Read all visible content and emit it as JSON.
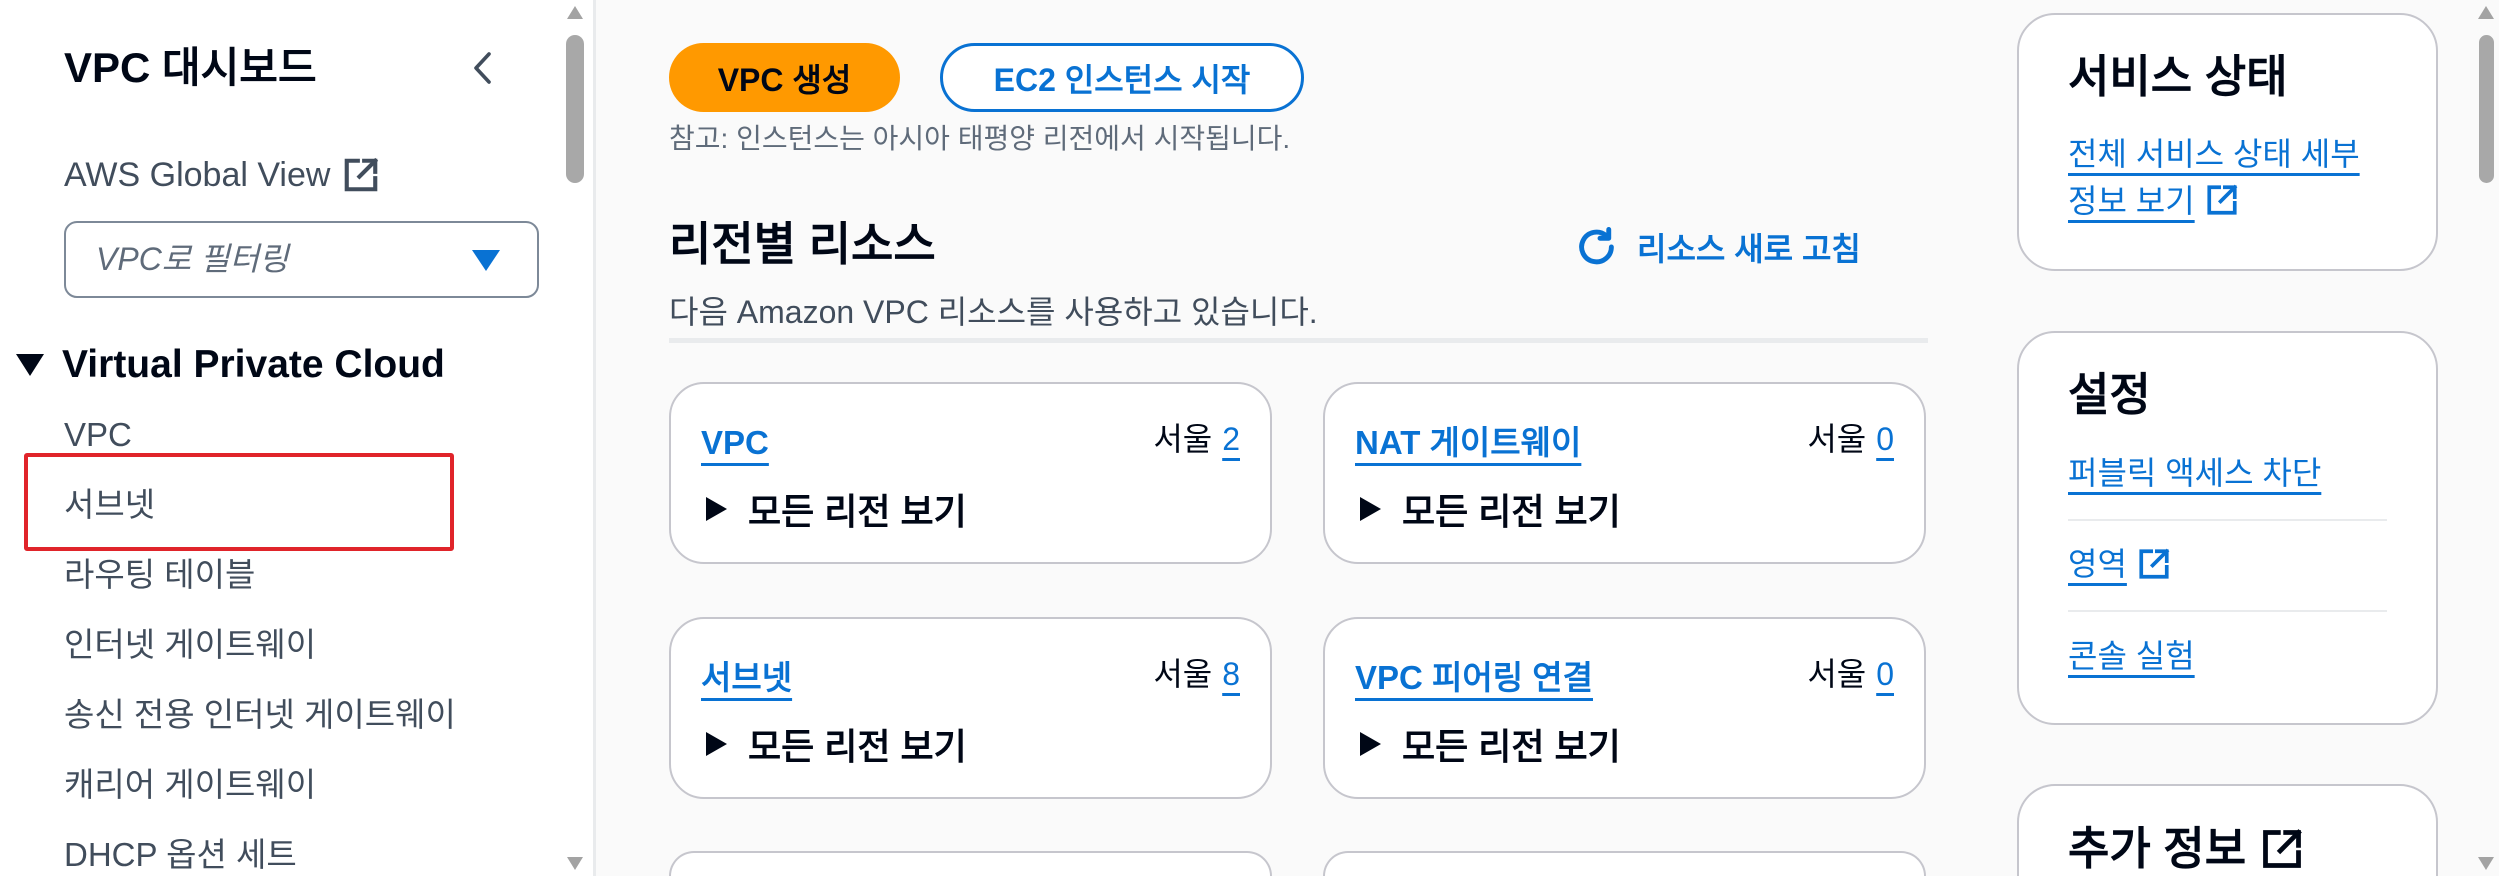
{
  "sidebar": {
    "title": "VPC 대시보드",
    "collapse_icon": "chevron-left-icon",
    "global_view": {
      "label": "AWS Global View",
      "icon": "external-link-icon"
    },
    "filter": {
      "placeholder": "VPC로 필터링",
      "icon": "caret-down-icon"
    },
    "section": {
      "title": "Virtual Private Cloud",
      "expanded": true,
      "icon": "caret-down-icon"
    },
    "items": [
      {
        "label": "VPC"
      },
      {
        "label": "서브넷",
        "highlighted": true
      },
      {
        "label": "라우팅 테이블"
      },
      {
        "label": "인터넷 게이트웨이"
      },
      {
        "label": "송신 전용 인터넷 게이트웨이"
      },
      {
        "label": "캐리어 게이트웨이"
      },
      {
        "label": "DHCP 옵션 세트"
      }
    ]
  },
  "actions": {
    "create_vpc_label": "VPC 생성",
    "launch_instance_label": "EC2 인스턴스 시작",
    "note": "참고: 인스턴스는 아시아 태평양 리전에서 시작됩니다."
  },
  "resources": {
    "title": "리전별 리소스",
    "refresh_label": "리소스 새로 고침",
    "refresh_icon": "refresh-icon",
    "description": "다음 Amazon VPC 리소스를 사용하고 있습니다.",
    "expand_icon": "caret-right-icon",
    "cards": [
      {
        "name": "VPC",
        "region": "서울",
        "count": "2",
        "expand_label": "모든 리전 보기"
      },
      {
        "name": "NAT 게이트웨이",
        "region": "서울",
        "count": "0",
        "expand_label": "모든 리전 보기"
      },
      {
        "name": "서브넷",
        "region": "서울",
        "count": "8",
        "expand_label": "모든 리전 보기"
      },
      {
        "name": "VPC 피어링 연결",
        "region": "서울",
        "count": "0",
        "expand_label": "모든 리전 보기"
      }
    ]
  },
  "service_health": {
    "title": "서비스 상태",
    "details_link": "전체 서비스 상태 세부 정보 보기",
    "details_icon": "external-link-icon"
  },
  "settings": {
    "title": "설정",
    "links": [
      {
        "label": "퍼블릭 액세스 차단",
        "external": false
      },
      {
        "label": "영역",
        "external": true
      },
      {
        "label": "콘솔 실험",
        "external": false
      }
    ]
  },
  "additional_info": {
    "title": "추가 정보",
    "icon": "external-link-icon"
  },
  "colors": {
    "link": "#0972d3",
    "primary_button": "#ff9900",
    "highlight_box": "#e0242a",
    "text": "#000716",
    "secondary_text": "#414d5c"
  }
}
